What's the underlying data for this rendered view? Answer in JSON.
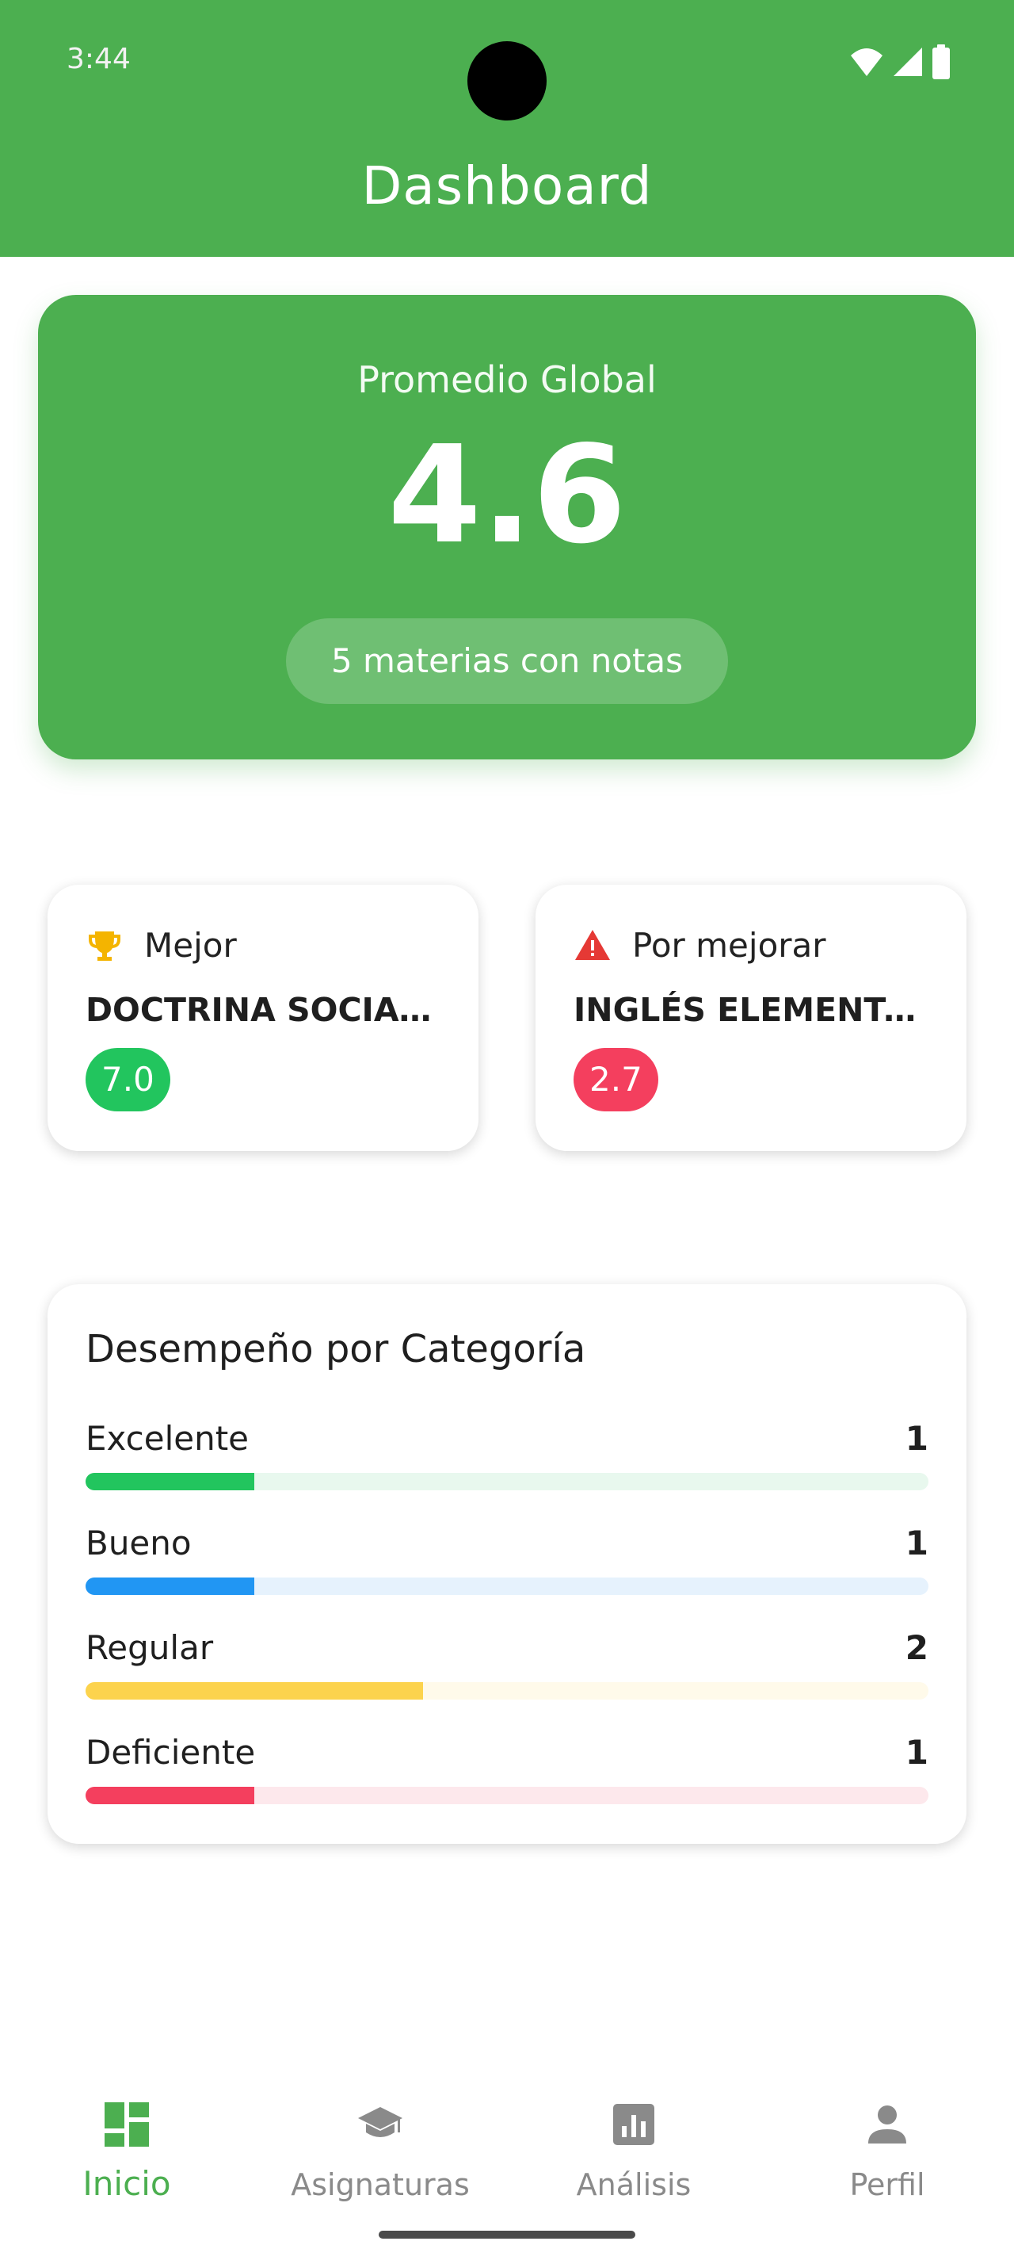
{
  "status_bar": {
    "time": "3:44",
    "icons": [
      "wifi-icon",
      "signal-icon",
      "battery-icon"
    ]
  },
  "header": {
    "title": "Dashboard"
  },
  "global": {
    "label": "Promedio Global",
    "value": "4.6",
    "pill": "5 materias con notas"
  },
  "best": {
    "label": "Mejor",
    "icon": "trophy-icon",
    "subject": "DOCTRINA SOCIAL D...",
    "grade": "7.0",
    "color": "#22c55e"
  },
  "worst": {
    "label": "Por mejorar",
    "icon": "warning-icon",
    "subject": "INGLÉS ELEMENTAL II",
    "grade": "2.7",
    "color": "#f43f5e"
  },
  "categories": {
    "title": "Desempeño por Categoría",
    "max_count": 5,
    "items": [
      {
        "label": "Excelente",
        "count": "1",
        "fraction": 0.2,
        "color": "#22c55e",
        "track": "#e8f8ee"
      },
      {
        "label": "Bueno",
        "count": "1",
        "fraction": 0.2,
        "color": "#2196f3",
        "track": "#e6f2fd"
      },
      {
        "label": "Regular",
        "count": "2",
        "fraction": 0.4,
        "color": "#fcd34d",
        "track": "#fffaea"
      },
      {
        "label": "Deficiente",
        "count": "1",
        "fraction": 0.2,
        "color": "#f43f5e",
        "track": "#fde8ec"
      }
    ]
  },
  "nav": {
    "items": [
      {
        "label": "Inicio",
        "icon": "dashboard-icon",
        "active": true
      },
      {
        "label": "Asignaturas",
        "icon": "school-icon",
        "active": false
      },
      {
        "label": "Análisis",
        "icon": "analytics-icon",
        "active": false
      },
      {
        "label": "Perfil",
        "icon": "person-icon",
        "active": false
      }
    ]
  },
  "colors": {
    "primary": "#4caf50",
    "inactive": "#8a8a8a"
  }
}
